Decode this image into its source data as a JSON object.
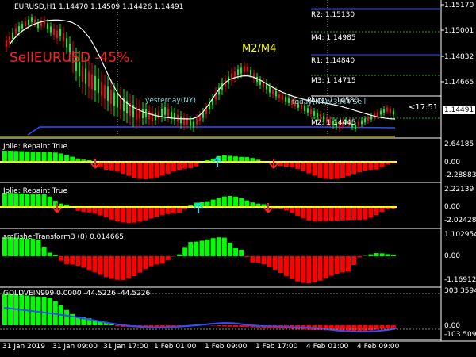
{
  "main": {
    "symbol_line": "EURUSD,H1  1.14470 1.14509 1.14426 1.14491",
    "signal_text": "SellEURUSD -45%.",
    "m2m4_text": "M2/M4",
    "yesterday_text": "yesterday(NY)",
    "today_text": "today(NY)",
    "session_text": "M3:M4 Sell",
    "countdown": "<17:51",
    "current_price": "1.14491",
    "price_axis": [
      "1.15170",
      "1.15001",
      "1.14832",
      "1.14665",
      "1.14491"
    ],
    "levels": [
      {
        "name": "R2",
        "text": "R2: 1.15130",
        "color": "#2f4fff"
      },
      {
        "name": "M4",
        "text": "M4: 1.14985",
        "color": "#2fa82f"
      },
      {
        "name": "R1",
        "text": "R1: 1.14840",
        "color": "#2f4fff"
      },
      {
        "name": "M3",
        "text": "M3: 1.14715",
        "color": "#2fa82f"
      },
      {
        "name": "Pivot",
        "text": "Pivot: 1.14580",
        "color": "#ffffff"
      },
      {
        "name": "M2",
        "text": "M2: 1.14445",
        "color": "#2fa82f"
      }
    ]
  },
  "indicators": [
    {
      "title": "Jolie: Repaint True",
      "axis": [
        "2.64185",
        "0.00",
        "-2.28883"
      ]
    },
    {
      "title": "Jolie: Repaint True",
      "axis": [
        "2.22139",
        "0.00",
        "-2.02428"
      ]
    },
    {
      "title": "smFisherTransform3 (8) 0.014665",
      "axis": [
        "1.102954",
        "0.00",
        "-1.169121"
      ]
    },
    {
      "title": "GOLDVEIN999 0.0000 -44.5226 -44.5226",
      "axis": [
        "303.3594",
        "0.00",
        "-103.5097"
      ]
    }
  ],
  "time_axis": [
    "31 Jan 2019",
    "31 Jan 09:00",
    "31 Jan 17:00",
    "1 Feb 01:00",
    "1 Feb 09:00",
    "1 Feb 17:00",
    "4 Feb 01:00",
    "4 Feb 09:00"
  ],
  "colors": {
    "bull": "#00ff00",
    "bear": "#ff0000",
    "signal": "#ff0000",
    "m2m4": "#ffff00",
    "level_blue": "#2f4fff",
    "level_green": "#2fa82f"
  }
}
